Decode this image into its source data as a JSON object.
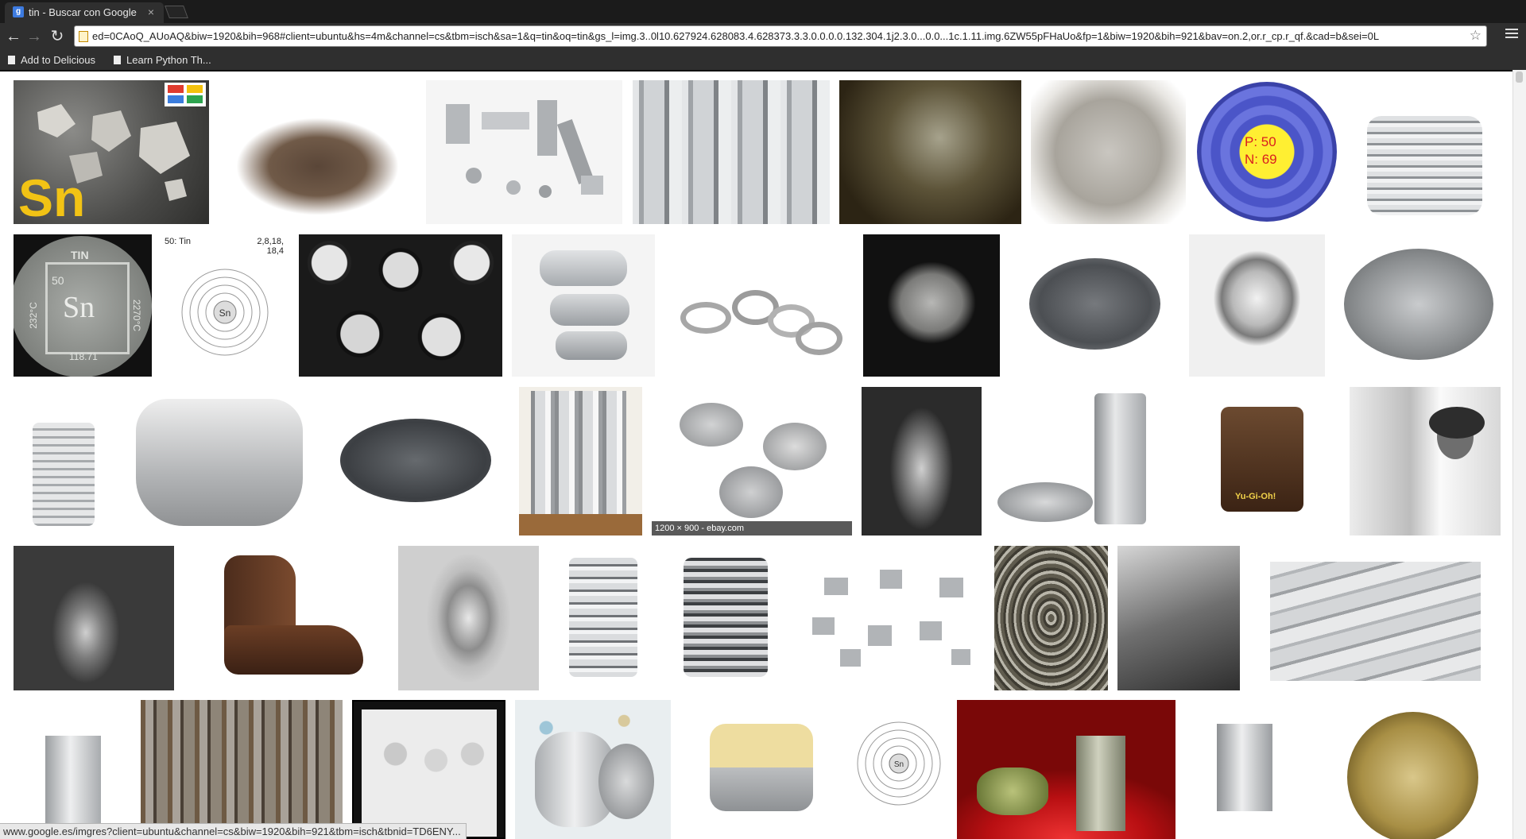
{
  "tab": {
    "title": "tin - Buscar con Google",
    "close": "×",
    "favicon": "g"
  },
  "toolbar": {
    "back": "←",
    "forward": "→",
    "reload": "↻",
    "url": "ed=0CAoQ_AUoAQ&biw=1920&bih=968#client=ubuntu&hs=4m&channel=cs&tbm=isch&sa=1&q=tin&oq=tin&gs_l=img.3..0l10.627924.628083.4.628373.3.3.0.0.0.0.132.304.1j2.3.0...0.0...1c.1.11.img.6ZW55pFHaUo&fp=1&biw=1920&bih=921&bav=on.2,or.r_cp.r_qf.&cad=b&sei=0L",
    "star": "☆"
  },
  "bookmarks": [
    "Add to Delicious",
    "Learn Python Th..."
  ],
  "thumbs": {
    "sn_symbol": "Sn",
    "proton_count": "P: 50",
    "neutron_count": "N: 69",
    "coin_top": "TIN",
    "coin_number": "50",
    "coin_symbol": "Sn",
    "coin_left": "232°C",
    "coin_bottom": "118.71",
    "coin_right": "2270°C",
    "shell_label": "50: Tin",
    "shell_config": "2,8,18,\n18,4",
    "hover_caption": "1200 × 900 - ebay.com",
    "yugioh": "Yu-Gi-Oh!"
  },
  "status_url": "www.google.es/imgres?client=ubuntu&channel=cs&biw=1920&bih=921&tbm=isch&tbnid=TD6ENY..."
}
